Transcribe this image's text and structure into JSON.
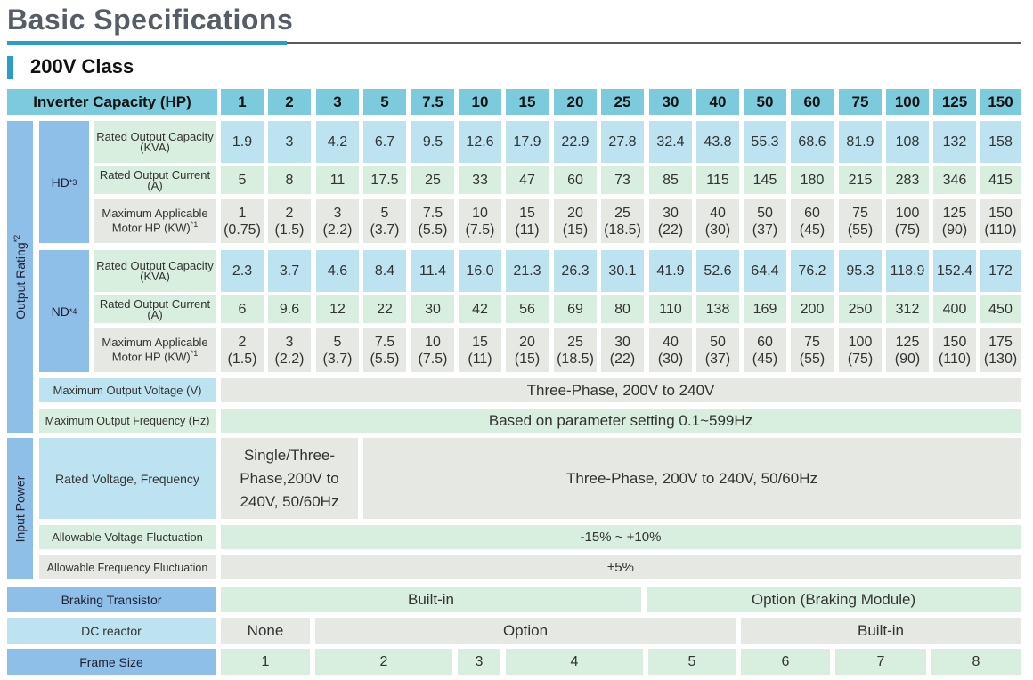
{
  "page_title": "Basic Specifications",
  "section_title": "200V Class",
  "header": {
    "label": "Inverter Capacity (HP)",
    "capacities": [
      "1",
      "2",
      "3",
      "5",
      "7.5",
      "10",
      "15",
      "20",
      "25",
      "30",
      "40",
      "50",
      "60",
      "75",
      "100",
      "125",
      "150"
    ]
  },
  "output_rating": {
    "label": "Output Rating",
    "label_sup": "*2",
    "hd": {
      "label": "HD",
      "label_sup": "*3",
      "rated_capacity_label": "Rated Output Capacity (KVA)",
      "rated_capacity": [
        "1.9",
        "3",
        "4.2",
        "6.7",
        "9.5",
        "12.6",
        "17.9",
        "22.9",
        "27.8",
        "32.4",
        "43.8",
        "55.3",
        "68.6",
        "81.9",
        "108",
        "132",
        "158"
      ],
      "rated_current_label": "Rated Output Current (A)",
      "rated_current": [
        "5",
        "8",
        "11",
        "17.5",
        "25",
        "33",
        "47",
        "60",
        "73",
        "85",
        "115",
        "145",
        "180",
        "215",
        "283",
        "346",
        "415"
      ],
      "max_motor_label": "Maximum Applicable Motor HP (KW)",
      "max_motor_label_sup": "*1",
      "max_motor": [
        [
          "1",
          "(0.75)"
        ],
        [
          "2",
          "(1.5)"
        ],
        [
          "3",
          "(2.2)"
        ],
        [
          "5",
          "(3.7)"
        ],
        [
          "7.5",
          "(5.5)"
        ],
        [
          "10",
          "(7.5)"
        ],
        [
          "15",
          "(11)"
        ],
        [
          "20",
          "(15)"
        ],
        [
          "25",
          "(18.5)"
        ],
        [
          "30",
          "(22)"
        ],
        [
          "40",
          "(30)"
        ],
        [
          "50",
          "(37)"
        ],
        [
          "60",
          "(45)"
        ],
        [
          "75",
          "(55)"
        ],
        [
          "100",
          "(75)"
        ],
        [
          "125",
          "(90)"
        ],
        [
          "150",
          "(110)"
        ]
      ]
    },
    "nd": {
      "label": "ND",
      "label_sup": "*4",
      "rated_capacity_label": "Rated Output Capacity (KVA)",
      "rated_capacity": [
        "2.3",
        "3.7",
        "4.6",
        "8.4",
        "11.4",
        "16.0",
        "21.3",
        "26.3",
        "30.1",
        "41.9",
        "52.6",
        "64.4",
        "76.2",
        "95.3",
        "118.9",
        "152.4",
        "172"
      ],
      "rated_current_label": "Rated Output Current (A)",
      "rated_current": [
        "6",
        "9.6",
        "12",
        "22",
        "30",
        "42",
        "56",
        "69",
        "80",
        "110",
        "138",
        "169",
        "200",
        "250",
        "312",
        "400",
        "450"
      ],
      "max_motor_label": "Maximum Applicable Motor HP (KW)",
      "max_motor_label_sup": "*1",
      "max_motor": [
        [
          "2",
          "(1.5)"
        ],
        [
          "3",
          "(2.2)"
        ],
        [
          "5",
          "(3.7)"
        ],
        [
          "7.5",
          "(5.5)"
        ],
        [
          "10",
          "(7.5)"
        ],
        [
          "15",
          "(11)"
        ],
        [
          "20",
          "(15)"
        ],
        [
          "25",
          "(18.5)"
        ],
        [
          "30",
          "(22)"
        ],
        [
          "40",
          "(30)"
        ],
        [
          "50",
          "(37)"
        ],
        [
          "60",
          "(45)"
        ],
        [
          "75",
          "(55)"
        ],
        [
          "100",
          "(75)"
        ],
        [
          "125",
          "(90)"
        ],
        [
          "150",
          "(110)"
        ],
        [
          "175",
          "(130)"
        ]
      ]
    },
    "max_voltage_label": "Maximum Output Voltage (V)",
    "max_voltage": "Three-Phase, 200V to 240V",
    "max_frequency_label": "Maximum Output Frequency (Hz)",
    "max_frequency": "Based on parameter setting 0.1~599Hz"
  },
  "input_power": {
    "label": "Input Power",
    "rated_voltage_label": "Rated Voltage, Frequency",
    "rated_voltage_small": "Single/Three-Phase,200V to 240V, 50/60Hz",
    "rated_voltage_large": "Three-Phase, 200V to 240V, 50/60Hz",
    "voltage_fluct_label": "Allowable Voltage Fluctuation",
    "voltage_fluct": "-15% ~ +10%",
    "freq_fluct_label": "Allowable Frequency Fluctuation",
    "freq_fluct": "±5%"
  },
  "braking": {
    "label": "Braking Transistor",
    "a": "Built-in",
    "b": "Option (Braking Module)"
  },
  "dc_reactor": {
    "label": "DC reactor",
    "a": "None",
    "b": "Option",
    "c": "Built-in"
  },
  "frame_size": {
    "label": "Frame Size",
    "values": [
      "1",
      "2",
      "3",
      "4",
      "5",
      "6",
      "7",
      "8"
    ]
  },
  "colors": {
    "accent": "#2b9ec8",
    "header_cyan": "#7ccbdd",
    "side_blue": "#8dbfe8",
    "cell_blue": "#bde3f0",
    "cell_green": "#d8eede",
    "cell_grey": "#e6e8e3"
  }
}
